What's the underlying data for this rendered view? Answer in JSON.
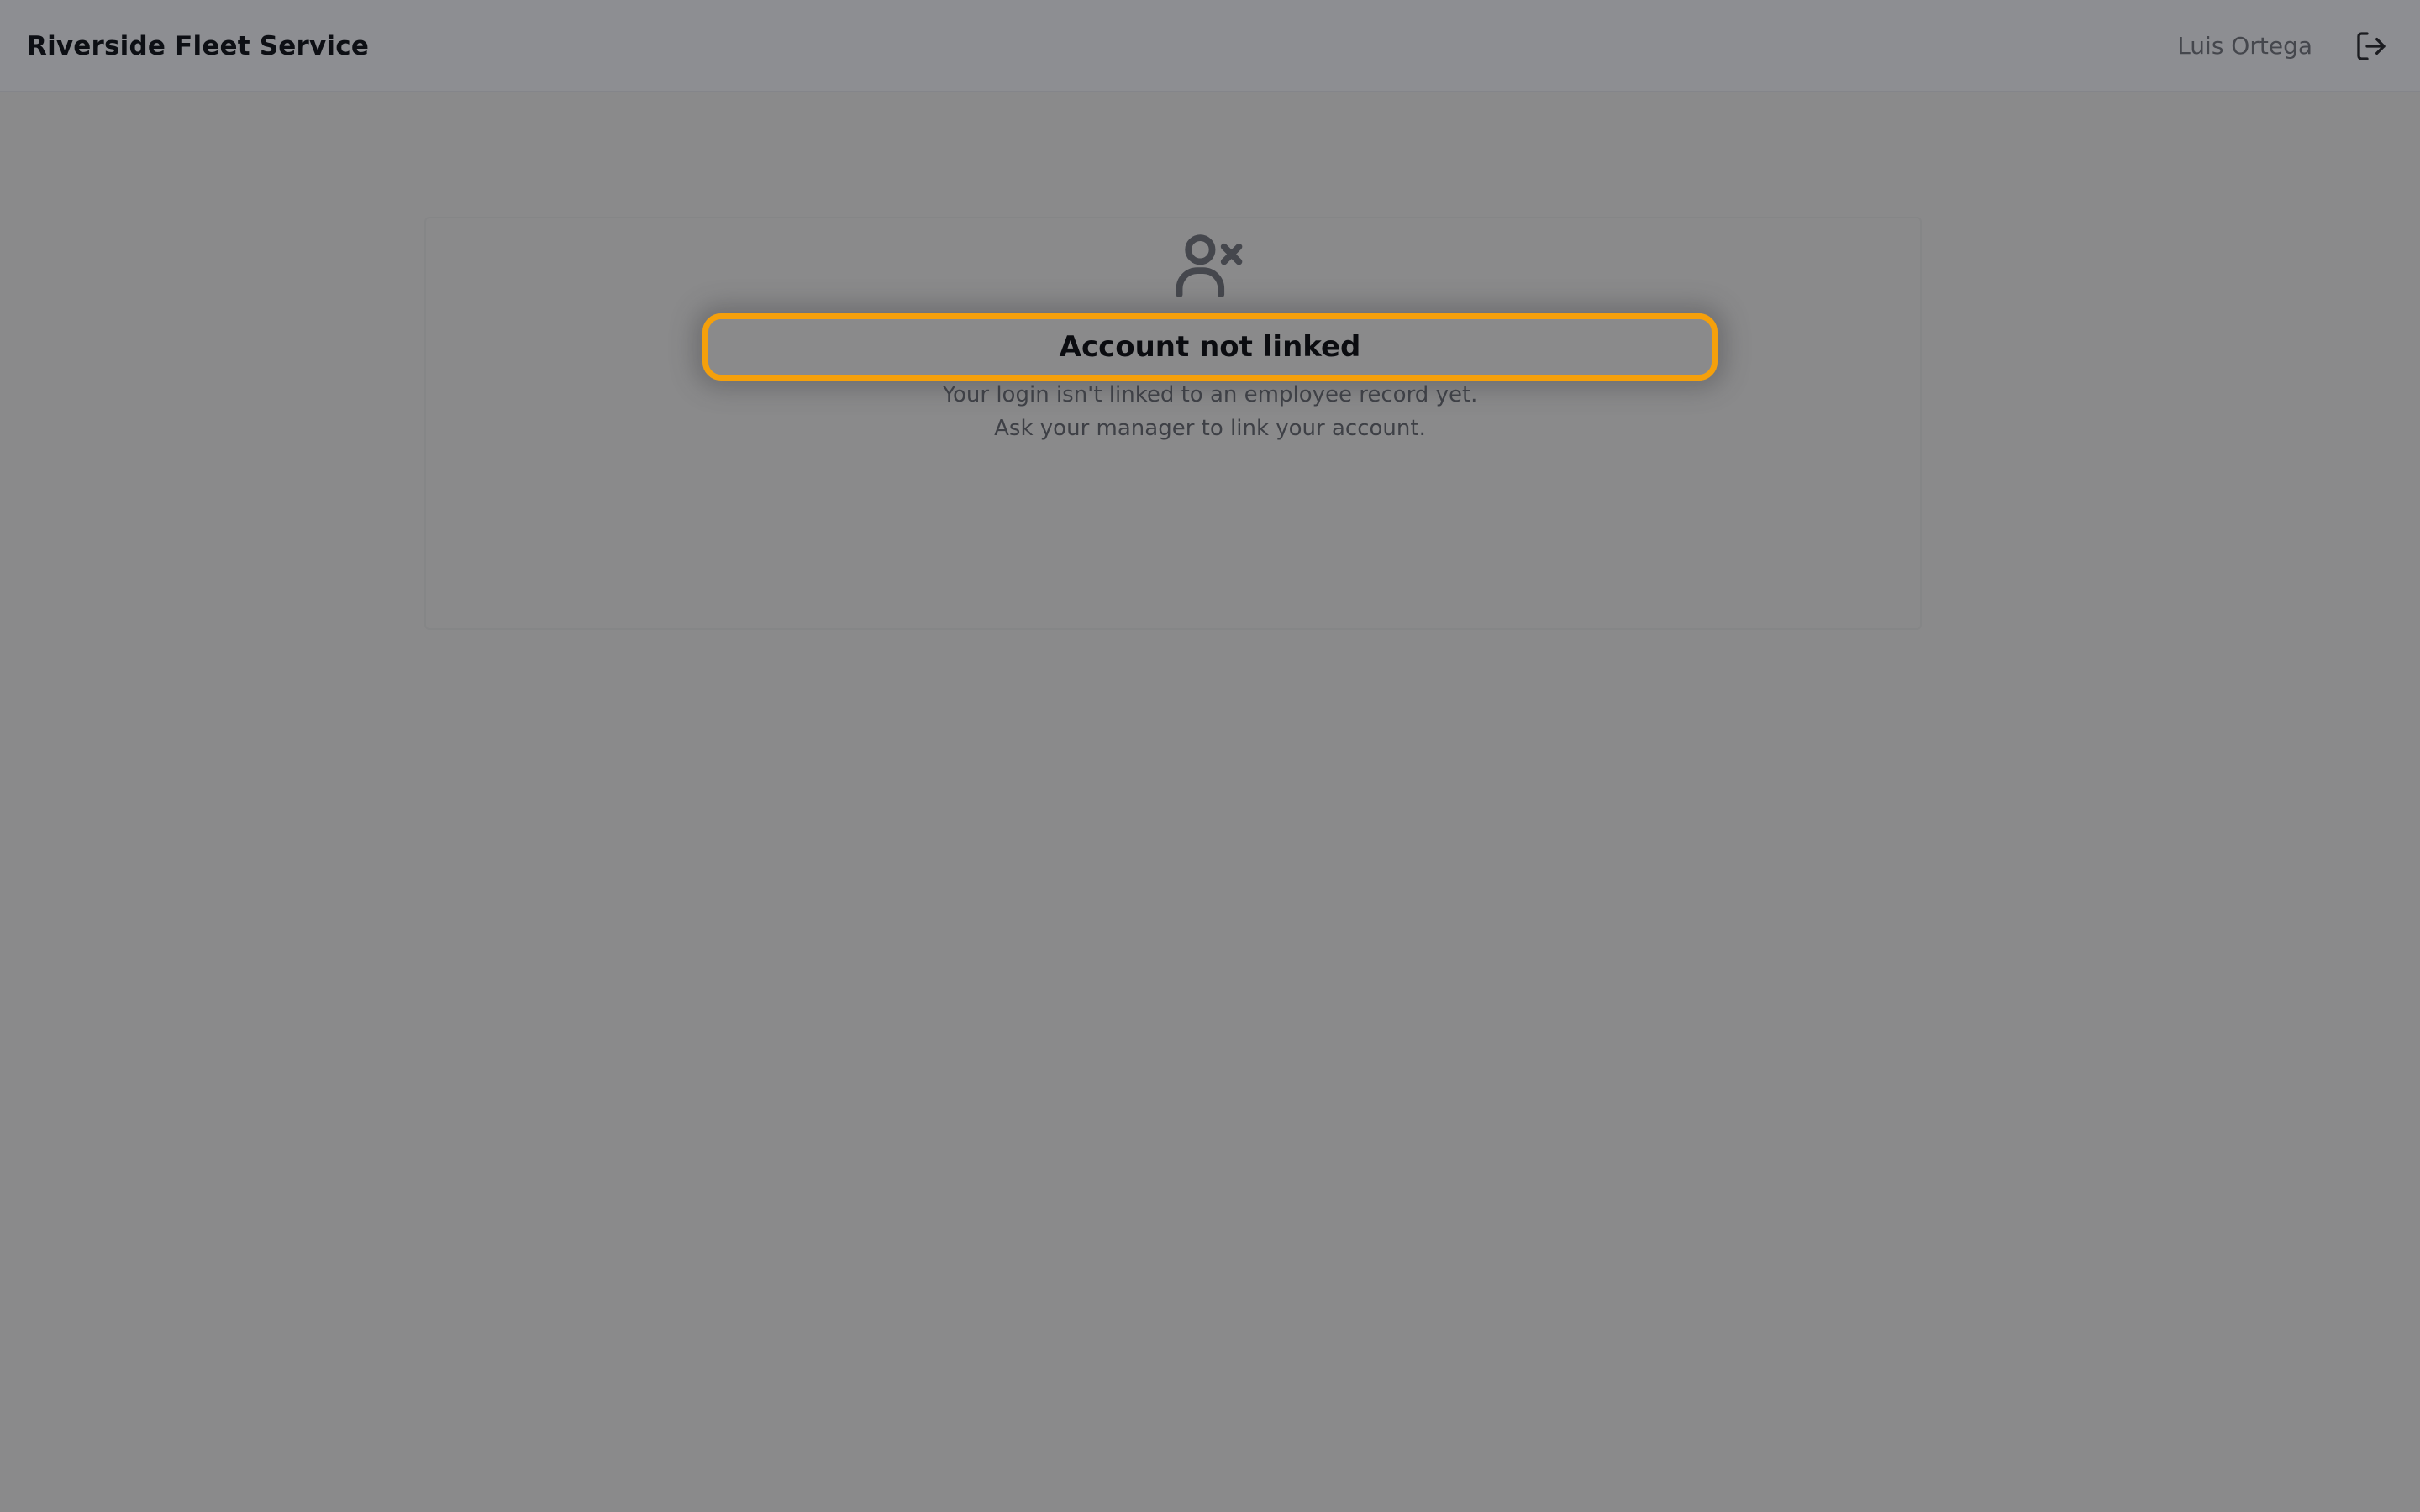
{
  "header": {
    "app_title": "Riverside Fleet Service",
    "user_name": "Luis Ortega",
    "logout_icon": "logout-icon"
  },
  "notice": {
    "icon": "user-x-icon",
    "title": "Account not linked",
    "message_line1": "Your login isn't linked to an employee record yet.",
    "message_line2": "Ask your manager to link your account.",
    "highlight_color": "#f5a00b"
  },
  "colors": {
    "background": "#8a8a8b",
    "header_background": "#8d8e92",
    "text_primary": "#0d0f14",
    "text_secondary": "#3e4046"
  }
}
